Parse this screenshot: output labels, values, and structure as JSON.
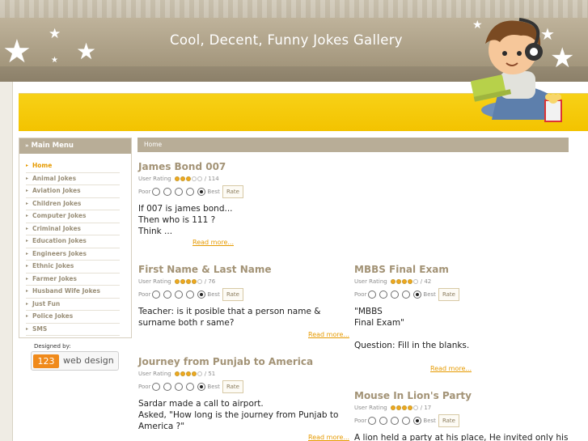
{
  "site": {
    "title": "Cool, Decent, Funny Jokes Gallery"
  },
  "sidebar": {
    "heading": "Main Menu",
    "items": [
      {
        "label": "Home",
        "active": true
      },
      {
        "label": "Animal Jokes"
      },
      {
        "label": "Aviation Jokes"
      },
      {
        "label": "Children Jokes"
      },
      {
        "label": "Computer Jokes"
      },
      {
        "label": "Criminal Jokes"
      },
      {
        "label": "Education Jokes"
      },
      {
        "label": "Engineers Jokes"
      },
      {
        "label": "Ethnic Jokes"
      },
      {
        "label": "Farmer Jokes"
      },
      {
        "label": "Husband Wife Jokes"
      },
      {
        "label": "Just Fun"
      },
      {
        "label": "Police Jokes"
      },
      {
        "label": "SMS"
      }
    ],
    "designed_by": "Designed by:",
    "badge_number": "123",
    "badge_text": "web design"
  },
  "breadcrumb": "Home",
  "labels": {
    "user_rating": "User Rating",
    "poor": "Poor",
    "best": "Best",
    "rate_button": "Rate",
    "read_more": "Read more..."
  },
  "articles": [
    {
      "title": "James Bond 007",
      "rating": 3,
      "votes": "/ 114",
      "body": [
        "If 007 is james bond...",
        "Then who is 111 ?",
        "Think ..."
      ]
    },
    {
      "title": "First Name & Last Name",
      "rating": 4,
      "votes": "/ 76",
      "body": [
        "Teacher: is it posible that a person name &",
        "surname both r same?"
      ]
    },
    {
      "title": "MBBS Final Exam",
      "rating": 4,
      "votes": "/ 42",
      "body": [
        "\"MBBS",
        "Final Exam\"",
        "",
        "Question: Fill in the blanks."
      ]
    },
    {
      "title": "Journey from Punjab to America",
      "rating": 4,
      "votes": "/ 51",
      "body": [
        "Sardar made a call to airport.",
        "Asked, \"How long is the journey from Punjab to",
        "America ?\""
      ]
    },
    {
      "title": "Mouse In Lion's Party",
      "rating": 4,
      "votes": "/ 17",
      "body": [
        "A lion held a party at his place, He invited only his"
      ]
    }
  ],
  "colors": {
    "accent": "#e69a00",
    "title": "#a39376",
    "band": "#b8ad97",
    "yellow": "#f5c800"
  }
}
